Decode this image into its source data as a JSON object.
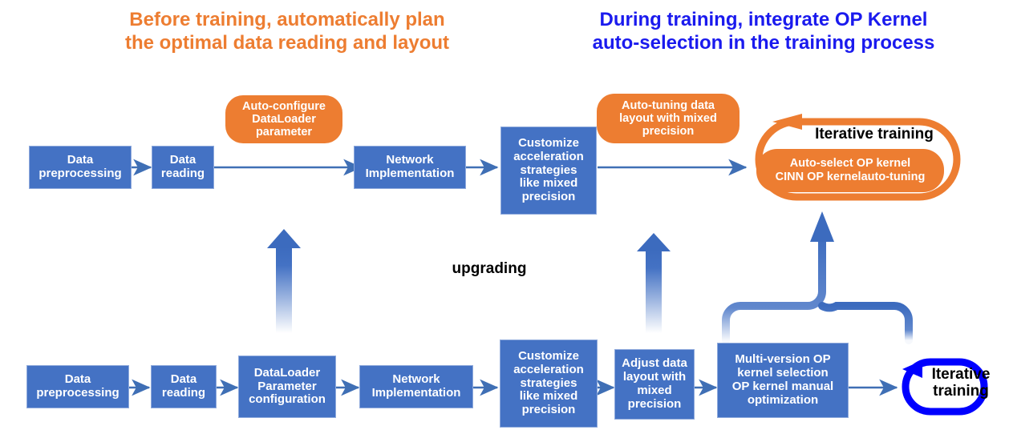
{
  "headings": {
    "left": {
      "line1": "Before training, automatically plan",
      "line2": "the optimal data reading and layout",
      "color": "#ED7D31"
    },
    "right": {
      "line1": "During training, integrate OP Kernel",
      "line2": "auto-selection in the training process",
      "color": "#1A1AEE"
    }
  },
  "middle_label": {
    "text": "upgrading"
  },
  "top_row": {
    "boxes": [
      {
        "line1": "Data",
        "line2": "preprocessing"
      },
      {
        "line1": "Data",
        "line2": "reading"
      },
      {
        "line1": "Network",
        "line2": "Implementation"
      },
      {
        "line1": "Customize",
        "line2": "acceleration",
        "line3": "strategies",
        "line4": "like mixed",
        "line5": "precision"
      }
    ],
    "bubbles": [
      {
        "line1": "Auto-configure",
        "line2": "DataLoader",
        "line3": "parameter"
      },
      {
        "line1": "Auto-tuning data",
        "line2": "layout with mixed",
        "line3": "precision"
      }
    ],
    "loop": {
      "title": "Iterative training",
      "pill_line1": "Auto-select OP kernel",
      "pill_line2": "CINN OP kernelauto-tuning",
      "color": "#ED7D31"
    }
  },
  "bottom_row": {
    "boxes": [
      {
        "line1": "Data",
        "line2": "preprocessing"
      },
      {
        "line1": "Data",
        "line2": "reading"
      },
      {
        "line1": "DataLoader",
        "line2": "Parameter",
        "line3": "configuration"
      },
      {
        "line1": "Network",
        "line2": "Implementation"
      },
      {
        "line1": "Customize",
        "line2": "acceleration",
        "line3": "strategies",
        "line4": "like mixed",
        "line5": "precision"
      },
      {
        "line1": "Adjust data",
        "line2": "layout with",
        "line3": "mixed",
        "line4": "precision"
      },
      {
        "line1": "Multi-version OP",
        "line2": "kernel selection",
        "line3": "OP kernel manual",
        "line4": "optimization"
      }
    ],
    "loop": {
      "line1": "Iterative",
      "line2": "training",
      "color": "#0000FF"
    }
  },
  "palette": {
    "box_fill": "#4472C4",
    "box_border": "#8FAADC",
    "orange": "#ED7D31",
    "arrow_blue": "#4472C4",
    "loop_blue": "#0000FF",
    "background": "#FFFFFF"
  },
  "icons": {
    "flow_arrow": "arrow-right-icon",
    "upgrade_arrow": "arrow-up-icon",
    "loop_arrow": "loop-arrow-icon",
    "merge_arrow": "merge-arrow-up-icon"
  }
}
